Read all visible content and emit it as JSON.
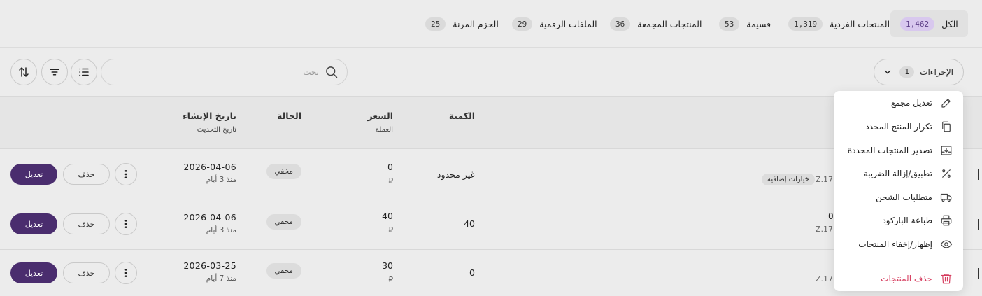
{
  "tabs": [
    {
      "label": "الكل",
      "count": "1,462",
      "active": true
    },
    {
      "label": "المنتجات الفردية",
      "count": "1,319"
    },
    {
      "label": "قسيمة",
      "count": "53"
    },
    {
      "label": "المنتجات المجمعة",
      "count": "36"
    },
    {
      "label": "الملفات الرقمية",
      "count": "29"
    },
    {
      "label": "الحزم المرنة",
      "count": "25"
    }
  ],
  "toolbar": {
    "actions_label": "الإجراءات",
    "actions_count": "1",
    "search_placeholder": "بحث"
  },
  "table": {
    "headers": {
      "quantity": "الكمية",
      "price": "السعر",
      "price_sub": "العملة",
      "status": "الحالة",
      "created": "تاريخ الإنشاء",
      "updated": "تاريخ التحديث"
    },
    "rows": [
      {
        "quantity": "غير محدود",
        "price": "0",
        "currency": "⃁",
        "status": "مخفي",
        "date": "2026-04-06",
        "ago": "منذ 3 أيام",
        "delete": "حذف",
        "edit": "تعديل",
        "chip": "خيارات إضافية",
        "sku": "Z.17",
        "peek": ""
      },
      {
        "quantity": "40",
        "price": "40",
        "currency": "⃁",
        "status": "مخفي",
        "date": "2026-04-06",
        "ago": "منذ 3 أيام",
        "delete": "حذف",
        "edit": "تعديل",
        "chip": "",
        "sku": "Z.17",
        "peek": "0"
      },
      {
        "quantity": "0",
        "price": "30",
        "currency": "⃁",
        "status": "مخفي",
        "date": "2026-03-25",
        "ago": "منذ 7 أيام",
        "delete": "حذف",
        "edit": "تعديل",
        "chip": "",
        "sku": "Z.17",
        "peek": ""
      }
    ]
  },
  "menu": {
    "items": [
      {
        "label": "تعديل مجمع",
        "icon": "pencil-icon"
      },
      {
        "label": "تكرار المنتج المحدد",
        "icon": "copy-icon"
      },
      {
        "label": "تصدير المنتجات المحددة",
        "icon": "export-icon"
      },
      {
        "label": "تطبيق/إزالة الضريبة",
        "icon": "percent-icon"
      },
      {
        "label": "متطلبات الشحن",
        "icon": "truck-icon"
      },
      {
        "label": "طباعة الباركود",
        "icon": "printer-icon"
      },
      {
        "label": "إظهار/إخفاء المنتجات",
        "icon": "eye-icon"
      }
    ],
    "delete_label": "حذف المنتجات",
    "delete_icon": "trash-icon"
  },
  "colors": {
    "accent": "#4a2d6e",
    "danger": "#d63c5e",
    "active_badge": "#d8c8ee"
  }
}
